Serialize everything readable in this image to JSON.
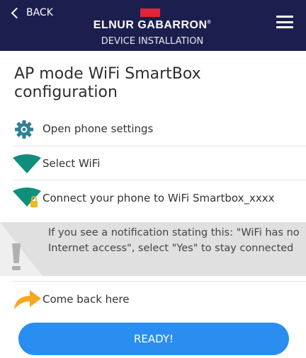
{
  "header": {
    "back_label": "BACK",
    "brand": "ELNUR GABARRON",
    "subtitle": "DEVICE INSTALLATION"
  },
  "page_title": "AP mode WiFi SmartBox configuration",
  "steps": [
    {
      "icon": "gear-icon",
      "label": "Open phone settings"
    },
    {
      "icon": "wifi-icon",
      "label": "Select WiFi"
    },
    {
      "icon": "wifi-lock-icon",
      "label": "Connect your phone to WiFi Smartbox_xxxx"
    }
  ],
  "warning": {
    "icon": "warning-icon",
    "text": "If you see a notification stating this: \"WiFi has no Internet access\", select \"Yes\" to stay connected"
  },
  "final_step": {
    "icon": "arrow-icon",
    "label": "Come back here"
  },
  "ready_button": "READY!",
  "colors": {
    "header_bg": "#1c1f4e",
    "accent_red": "#e2233b",
    "wifi_green": "#0f8f7b",
    "arrow_orange": "#f5a623",
    "button_blue": "#2a8ef0",
    "warning_bg": "#e0e0e0"
  }
}
